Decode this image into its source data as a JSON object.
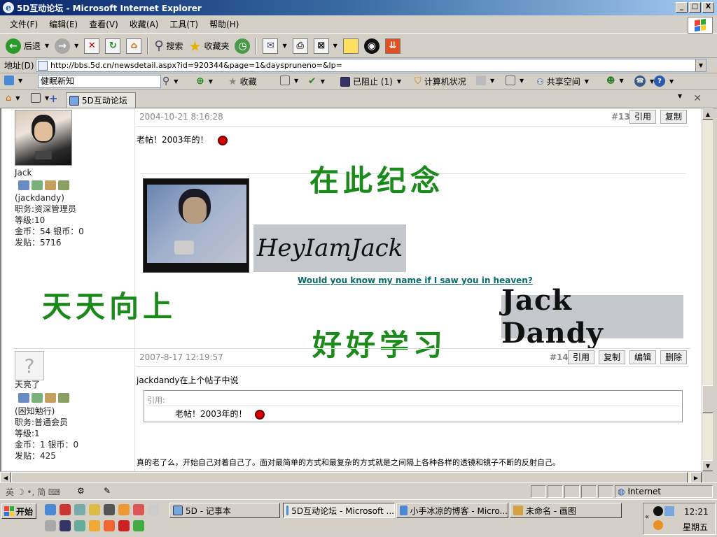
{
  "window": {
    "title": "5D互动论坛 - Microsoft Internet Explorer",
    "min": "_",
    "max": "□",
    "close": "X"
  },
  "menu": [
    "文件(F)",
    "编辑(E)",
    "查看(V)",
    "收藏(A)",
    "工具(T)",
    "帮助(H)"
  ],
  "toolbar": {
    "back": "后退",
    "search": "搜索",
    "favorites": "收藏夹"
  },
  "address": {
    "label": "地址(D)",
    "url": "http://bbs.5d.cn/newsdetail.aspx?id=920344&page=1&dayspruneno=&lp="
  },
  "linkbar": {
    "search_value": "健眠新知",
    "favorites": "收藏",
    "blocked": "已阻止 (1)",
    "computer_status": "计算机状况",
    "share": "共享空间"
  },
  "tab": {
    "label": "5D互动论坛"
  },
  "posts": [
    {
      "date": "2004-10-21 8:16:28",
      "number": "#13",
      "buttons": [
        "引用",
        "复制"
      ],
      "user": {
        "name": "Jack",
        "handle": "(jackdandy)",
        "role": "职务:资深管理员",
        "level": "等级:10",
        "coins": "金币：54 银币：0",
        "posts": "发贴：5716"
      },
      "text": "老帖！2003年的！",
      "banner_big": "在此纪念",
      "sign_text": "HeyIamJack",
      "sign_link": "Would you know my name if I saw you in heaven?",
      "banner_left": "天天向上",
      "banner_bottom": "好好学习",
      "sign_gothic": "Jack Dandy"
    },
    {
      "date": "2007-8-17 12:19:57",
      "number": "#14",
      "buttons": [
        "引用",
        "复制",
        "编辑",
        "删除"
      ],
      "user": {
        "avatar_q": "?",
        "name": "天亮了",
        "handle": "(困知勉行)",
        "role": "职务:普通会员",
        "level": "等级:1",
        "coins": "金币：1 银币：0",
        "posts": "发贴：425"
      },
      "text": "jackdandy在上个帖子中说",
      "quote_label": "引用:",
      "quote_text": "老帖！2003年的！",
      "footer_text": "真的老了么，开始自己对着自己了。面对最简单的方式和最复杂的方式就是之间隔上各种各样的透镜和镜子不断的反射自己。"
    }
  ],
  "status": {
    "ime": "英 ☽ •, 简 ⌨",
    "zone": "Internet"
  },
  "taskbar": {
    "start": "开始",
    "tasks": [
      "5D - 记事本",
      "5D互动论坛 - Microsoft ...",
      "小手冰凉的博客 - Micro...",
      "未命名 - 画图"
    ],
    "clock": "12:21",
    "day": "星期五"
  },
  "colors": {
    "title_start": "#0a246a",
    "title_end": "#a6caf0",
    "chrome": "#d4d0c8",
    "banner_green": "#1a8a1a",
    "link_teal": "#0a6b6b"
  }
}
